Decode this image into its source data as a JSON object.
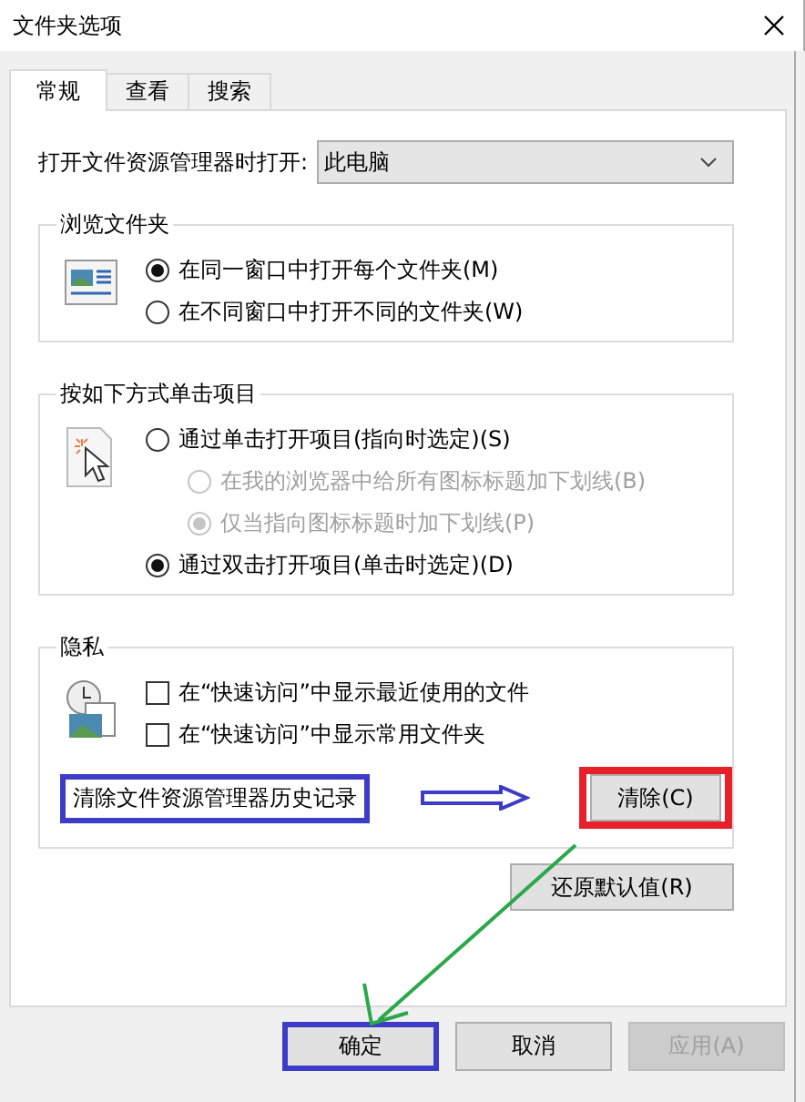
{
  "window": {
    "title": "文件夹选项"
  },
  "tabs": [
    {
      "label": "常规",
      "selected": true
    },
    {
      "label": "查看",
      "selected": false
    },
    {
      "label": "搜索",
      "selected": false
    }
  ],
  "open_in": {
    "label": "打开文件资源管理器时打开:",
    "value": "此电脑"
  },
  "browse_folders": {
    "title": "浏览文件夹",
    "options": [
      {
        "label": "在同一窗口中打开每个文件夹(M)",
        "selected": true
      },
      {
        "label": "在不同窗口中打开不同的文件夹(W)",
        "selected": false
      }
    ]
  },
  "click_items": {
    "title": "按如下方式单击项目",
    "options": [
      {
        "label": "通过单击打开项目(指向时选定)(S)",
        "selected": false,
        "disabled": false,
        "children": [
          {
            "label": "在我的浏览器中给所有图标标题加下划线(B)",
            "selected": false,
            "disabled": true
          },
          {
            "label": "仅当指向图标标题时加下划线(P)",
            "selected": true,
            "disabled": true
          }
        ]
      },
      {
        "label": "通过双击打开项目(单击时选定)(D)",
        "selected": true,
        "disabled": false
      }
    ]
  },
  "privacy": {
    "title": "隐私",
    "checkboxes": [
      {
        "label": "在“快速访问”中显示最近使用的文件",
        "checked": false
      },
      {
        "label": "在“快速访问”中显示常用文件夹",
        "checked": false
      }
    ],
    "history_label": {
      "text": "清除文件资源管理器历史记录",
      "highlighted": true
    },
    "clear_button": {
      "label": "清除(C)",
      "highlighted": true
    }
  },
  "restore_button": {
    "label": "还原默认值(R)"
  },
  "buttons": [
    {
      "label": "确定",
      "disabled": false,
      "highlighted": true
    },
    {
      "label": "取消",
      "disabled": false,
      "highlighted": false
    },
    {
      "label": "应用(A)",
      "disabled": true,
      "highlighted": false
    }
  ]
}
